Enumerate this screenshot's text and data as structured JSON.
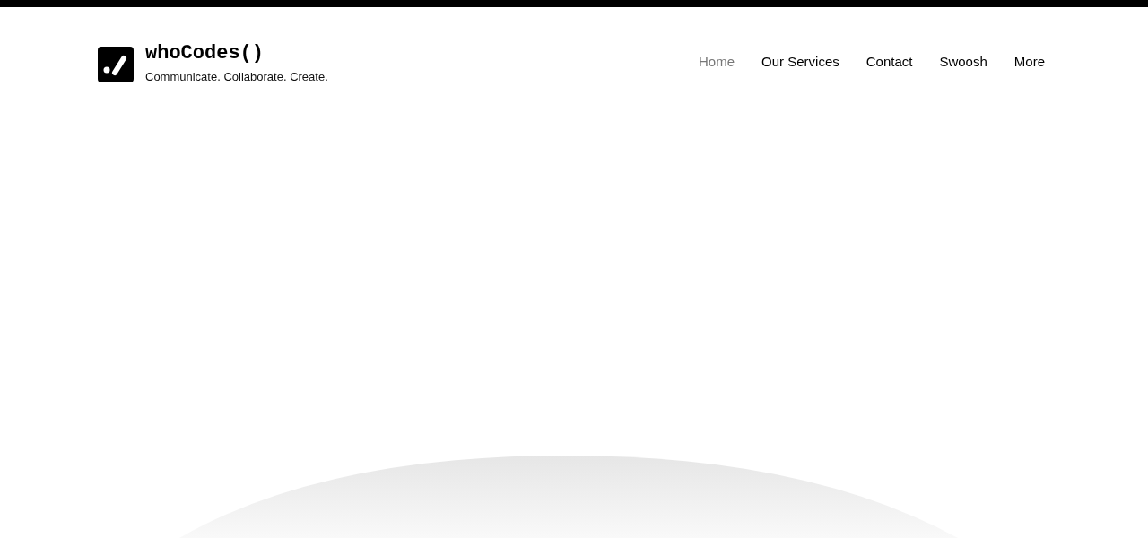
{
  "brand": {
    "name": "whoCodes()",
    "tagline": "Communicate. Collaborate. Create."
  },
  "nav": [
    {
      "label": "Home",
      "selected": true
    },
    {
      "label": "Our Services",
      "selected": false
    },
    {
      "label": "Contact",
      "selected": false
    },
    {
      "label": "Swoosh",
      "selected": false
    },
    {
      "label": "More",
      "selected": false
    }
  ]
}
